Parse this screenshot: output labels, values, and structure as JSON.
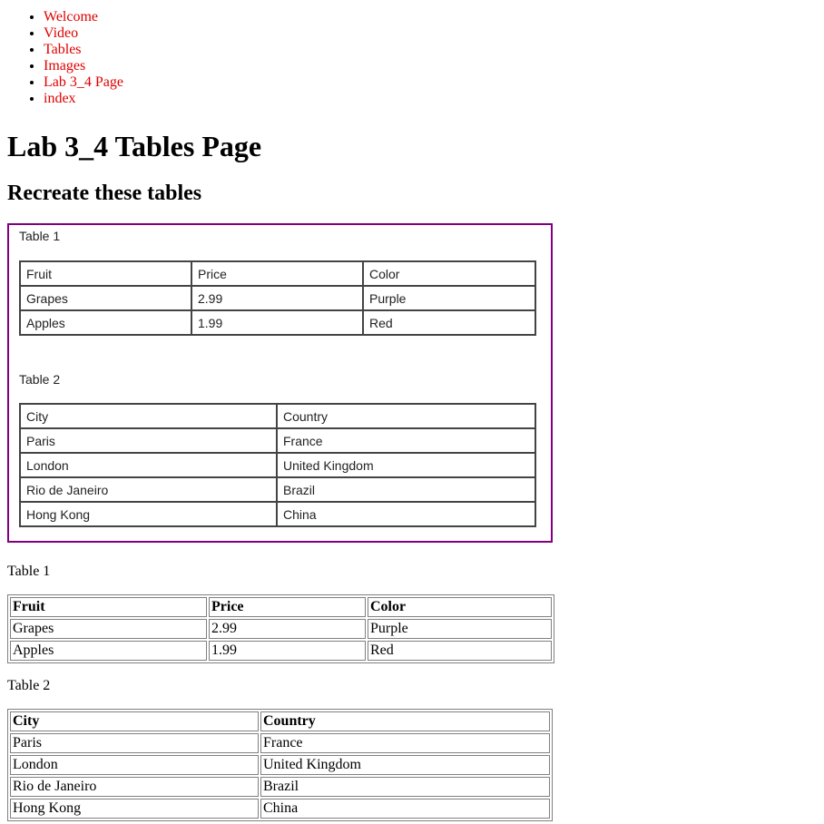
{
  "nav": [
    "Welcome",
    "Video",
    "Tables",
    "Images",
    "Lab 3_4 Page",
    "index"
  ],
  "page_title": "Lab 3_4 Tables Page",
  "subtitle": "Recreate these tables",
  "reference": {
    "table1_caption": "Table 1",
    "table1": [
      [
        "Fruit",
        "Price",
        "Color"
      ],
      [
        "Grapes",
        "2.99",
        "Purple"
      ],
      [
        "Apples",
        "1.99",
        "Red"
      ]
    ],
    "table2_caption": "Table 2",
    "table2": [
      [
        "City",
        "Country"
      ],
      [
        "Paris",
        "France"
      ],
      [
        "London",
        "United Kingdom"
      ],
      [
        "Rio de Janeiro",
        "Brazil"
      ],
      [
        "Hong Kong",
        "China"
      ]
    ]
  },
  "table1": {
    "caption": "Table 1",
    "headers": [
      "Fruit",
      "Price",
      "Color"
    ],
    "rows": [
      [
        "Grapes",
        "2.99",
        "Purple"
      ],
      [
        "Apples",
        "1.99",
        "Red"
      ]
    ]
  },
  "table2": {
    "caption": "Table 2",
    "headers": [
      "City",
      "Country"
    ],
    "rows": [
      [
        "Paris",
        "France"
      ],
      [
        "London",
        "United Kingdom"
      ],
      [
        "Rio de Janeiro",
        "Brazil"
      ],
      [
        "Hong Kong",
        "China"
      ]
    ]
  },
  "colors": {
    "link": "#e00000",
    "ref_border": "#800080"
  }
}
